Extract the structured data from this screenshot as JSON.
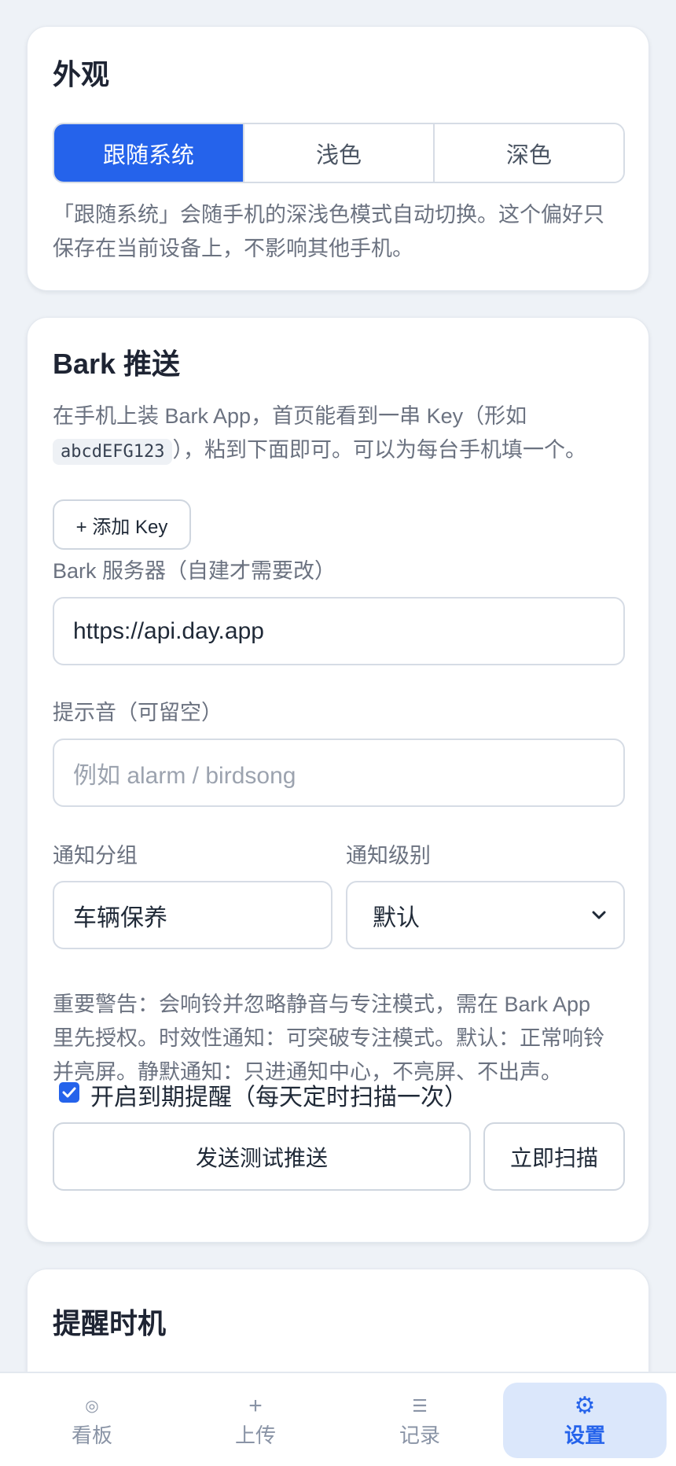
{
  "appearance": {
    "title": "外观",
    "options": [
      "跟随系统",
      "浅色",
      "深色"
    ],
    "selected": "跟随系统",
    "note_line1": "「跟随系统」会随手机的深浅色模式自动切换。这个偏好只",
    "note_line2": "保存在当前设备上，不影响其他手机。"
  },
  "bark": {
    "title": "Bark 推送",
    "intro_line1": "在手机上装 Bark App，首页能看到一串 Key（形如",
    "intro_example": "abcdEFG123",
    "intro_line2_rest": "），粘到下面即可。可以为每台手机填一个。",
    "add_key_label": "+ 添加 Key",
    "server_label": "Bark 服务器（自建才需要改）",
    "server_value": "https://api.day.app",
    "sound_label": "提示音（可留空）",
    "sound_placeholder": "例如 alarm / birdsong",
    "group_label": "通知分组",
    "group_value": "车辆保养",
    "level_label": "通知级别",
    "level_value": "默认",
    "level_note_line1": "重要警告：会响铃并忽略静音与专注模式，需在 Bark App",
    "level_note_line2": "里先授权。时效性通知：可突破专注模式。默认：正常响铃",
    "level_note_line3": "并亮屏。静默通知：只进通知中心，不亮屏、不出声。",
    "reminder_checkbox_label": "开启到期提醒（每天定时扫描一次）",
    "reminder_checked": true,
    "test_button": "发送测试推送",
    "scan_button": "立即扫描"
  },
  "timing": {
    "title": "提醒时机"
  },
  "tabbar": {
    "items": [
      {
        "label": "看板",
        "icon": "dashboard-icon",
        "glyph": "◎"
      },
      {
        "label": "上传",
        "icon": "plus-icon",
        "glyph": "+"
      },
      {
        "label": "记录",
        "icon": "list-icon",
        "glyph": "☰"
      },
      {
        "label": "设置",
        "icon": "gear-icon",
        "glyph": "⚙"
      }
    ],
    "active": "设置"
  },
  "colors": {
    "accent": "#2563eb",
    "active_tab_bg": "#dbe7fb",
    "page_bg": "#eef2f7"
  }
}
